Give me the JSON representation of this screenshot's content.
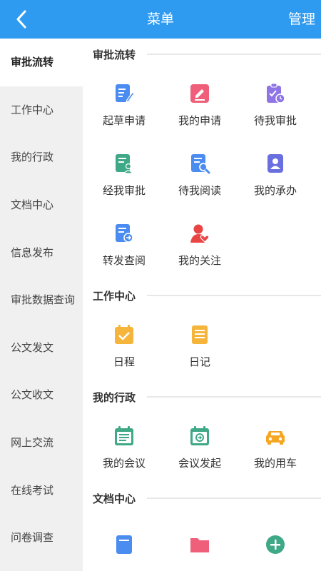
{
  "header": {
    "title": "菜单",
    "manage_label": "管理"
  },
  "sidebar": {
    "items": [
      {
        "label": "审批流转",
        "active": true
      },
      {
        "label": "工作中心"
      },
      {
        "label": "我的行政"
      },
      {
        "label": "文档中心"
      },
      {
        "label": "信息发布"
      },
      {
        "label": "审批数据查询"
      },
      {
        "label": "公文发文"
      },
      {
        "label": "公文收文"
      },
      {
        "label": "网上交流"
      },
      {
        "label": "在线考试"
      },
      {
        "label": "问卷调查"
      }
    ]
  },
  "sections": [
    {
      "title": "审批流转",
      "items": [
        {
          "label": "起草申请",
          "icon": "draft-edit-icon",
          "color": "#4a8cf0"
        },
        {
          "label": "我的申请",
          "icon": "pencil-note-icon",
          "color": "#ef5f7a"
        },
        {
          "label": "待我审批",
          "icon": "clipboard-clock-icon",
          "color": "#8f74e6"
        },
        {
          "label": "经我审批",
          "icon": "document-user-icon",
          "color": "#3fa886"
        },
        {
          "label": "待我阅读",
          "icon": "document-search-icon",
          "color": "#4a8cf0"
        },
        {
          "label": "我的承办",
          "icon": "contact-card-icon",
          "color": "#6a6fe0"
        },
        {
          "label": "转发查阅",
          "icon": "document-forward-icon",
          "color": "#4a8cf0"
        },
        {
          "label": "我的关注",
          "icon": "user-heart-icon",
          "color": "#e94545"
        }
      ]
    },
    {
      "title": "工作中心",
      "items": [
        {
          "label": "日程",
          "icon": "calendar-check-icon",
          "color": "#f5b53a"
        },
        {
          "label": "日记",
          "icon": "notebook-icon",
          "color": "#f5b53a"
        }
      ]
    },
    {
      "title": "我的行政",
      "items": [
        {
          "label": "我的会议",
          "icon": "meeting-calendar-icon",
          "color": "#3fa886"
        },
        {
          "label": "会议发起",
          "icon": "meeting-start-icon",
          "color": "#3fa886"
        },
        {
          "label": "我的用车",
          "icon": "car-icon",
          "color": "#f5a623"
        }
      ]
    },
    {
      "title": "文档中心",
      "items": [
        {
          "label": "",
          "icon": "document-icon",
          "color": "#4a8cf0"
        },
        {
          "label": "",
          "icon": "folder-icon",
          "color": "#ef5f7a"
        },
        {
          "label": "",
          "icon": "add-circle-icon",
          "color": "#3fa886"
        }
      ]
    }
  ]
}
